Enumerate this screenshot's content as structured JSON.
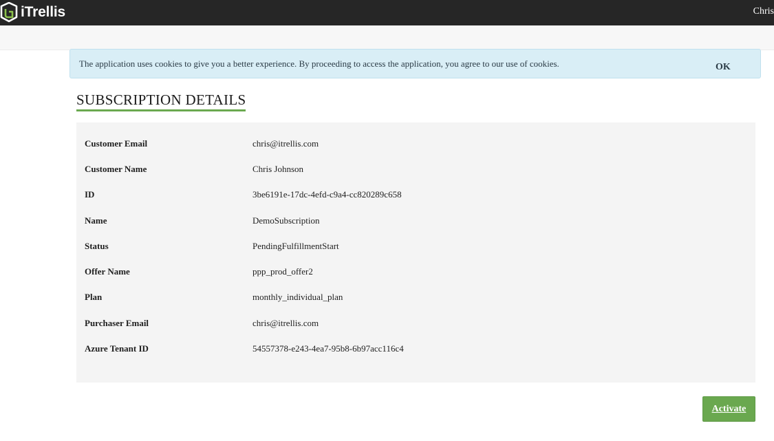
{
  "header": {
    "logo_text": "iTrellis",
    "user_name": "Chris"
  },
  "cookie_banner": {
    "message": "The application uses cookies to give you a better experience. By proceeding to access the application, you agree to our use of cookies.",
    "ok_label": "OK"
  },
  "page": {
    "title": "SUBSCRIPTION DETAILS"
  },
  "details": {
    "rows": [
      {
        "label": "Customer Email",
        "value": "chris@itrellis.com"
      },
      {
        "label": "Customer Name",
        "value": "Chris Johnson"
      },
      {
        "label": "ID",
        "value": "3be6191e-17dc-4efd-c9a4-cc820289c658"
      },
      {
        "label": "Name",
        "value": "DemoSubscription"
      },
      {
        "label": "Status",
        "value": "PendingFulfillmentStart"
      },
      {
        "label": "Offer Name",
        "value": "ppp_prod_offer2"
      },
      {
        "label": "Plan",
        "value": "monthly_individual_plan"
      },
      {
        "label": "Purchaser Email",
        "value": "chris@itrellis.com"
      },
      {
        "label": "Azure Tenant ID",
        "value": "54557378-e243-4ea7-95b8-6b97acc116c4"
      }
    ]
  },
  "actions": {
    "activate_label": "Activate"
  },
  "colors": {
    "topbar": "#262626",
    "accent_green": "#6aa84f",
    "banner_bg": "#d9eef6",
    "panel_bg": "#f4f4f4"
  }
}
